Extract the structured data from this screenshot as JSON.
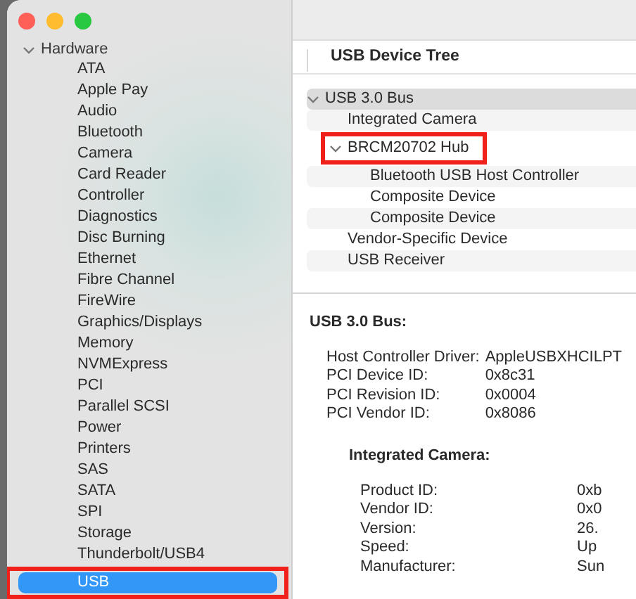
{
  "sidebar": {
    "group": {
      "label": "Hardware",
      "expanded": true,
      "items": [
        {
          "label": "ATA",
          "selected": false,
          "marked": false
        },
        {
          "label": "Apple Pay",
          "selected": false,
          "marked": false
        },
        {
          "label": "Audio",
          "selected": false,
          "marked": false
        },
        {
          "label": "Bluetooth",
          "selected": false,
          "marked": false
        },
        {
          "label": "Camera",
          "selected": false,
          "marked": false
        },
        {
          "label": "Card Reader",
          "selected": false,
          "marked": false
        },
        {
          "label": "Controller",
          "selected": false,
          "marked": false
        },
        {
          "label": "Diagnostics",
          "selected": false,
          "marked": false
        },
        {
          "label": "Disc Burning",
          "selected": false,
          "marked": false
        },
        {
          "label": "Ethernet",
          "selected": false,
          "marked": false
        },
        {
          "label": "Fibre Channel",
          "selected": false,
          "marked": false
        },
        {
          "label": "FireWire",
          "selected": false,
          "marked": false
        },
        {
          "label": "Graphics/Displays",
          "selected": false,
          "marked": false
        },
        {
          "label": "Memory",
          "selected": false,
          "marked": false
        },
        {
          "label": "NVMExpress",
          "selected": false,
          "marked": false
        },
        {
          "label": "PCI",
          "selected": false,
          "marked": false
        },
        {
          "label": "Parallel SCSI",
          "selected": false,
          "marked": false
        },
        {
          "label": "Power",
          "selected": false,
          "marked": false
        },
        {
          "label": "Printers",
          "selected": false,
          "marked": false
        },
        {
          "label": "SAS",
          "selected": false,
          "marked": false
        },
        {
          "label": "SATA",
          "selected": false,
          "marked": false
        },
        {
          "label": "SPI",
          "selected": false,
          "marked": false
        },
        {
          "label": "Storage",
          "selected": false,
          "marked": false
        },
        {
          "label": "Thunderbolt/USB4",
          "selected": false,
          "marked": false
        },
        {
          "label": "USB",
          "selected": true,
          "marked": true
        }
      ]
    }
  },
  "tree": {
    "title": "USB Device Tree",
    "nodes": [
      {
        "label": "USB 3.0 Bus",
        "expanded": true,
        "selected": true,
        "marked": false,
        "children": [
          {
            "label": "Integrated Camera",
            "selected": false,
            "marked": false
          },
          {
            "label": "BRCM20702 Hub",
            "expanded": true,
            "selected": false,
            "marked": true,
            "children": [
              {
                "label": "Bluetooth USB Host Controller",
                "selected": false,
                "marked": false
              },
              {
                "label": "Composite Device",
                "selected": false,
                "marked": false
              },
              {
                "label": "Composite Device",
                "selected": false,
                "marked": false
              }
            ]
          },
          {
            "label": "Vendor-Specific Device",
            "selected": false,
            "marked": false
          },
          {
            "label": "USB Receiver",
            "selected": false,
            "marked": false
          }
        ]
      }
    ]
  },
  "details": [
    {
      "title": "USB 3.0 Bus:",
      "properties": [
        {
          "label": "Host Controller Driver:",
          "value": "AppleUSBXHCILPT"
        },
        {
          "label": "PCI Device ID:",
          "value": "0x8c31"
        },
        {
          "label": "PCI Revision ID:",
          "value": "0x0004"
        },
        {
          "label": "PCI Vendor ID:",
          "value": "0x8086"
        }
      ]
    },
    {
      "title": "Integrated Camera:",
      "properties": [
        {
          "label": "Product ID:",
          "value": "0xb"
        },
        {
          "label": "Vendor ID:",
          "value": "0x0"
        },
        {
          "label": "Version:",
          "value": "26."
        },
        {
          "label": "Speed:",
          "value": "Up"
        },
        {
          "label": "Manufacturer:",
          "value": "Sun"
        }
      ]
    }
  ]
}
